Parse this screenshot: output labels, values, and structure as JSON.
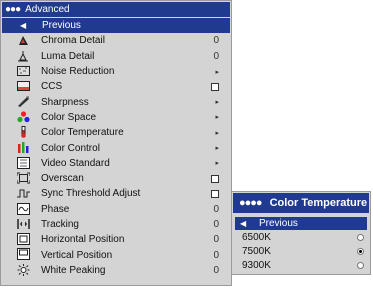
{
  "advanced_menu": {
    "title": "Advanced",
    "items": [
      {
        "label": "Previous",
        "selected": true
      },
      {
        "label": "Chroma Detail",
        "value": "0",
        "icon": "chroma-icon"
      },
      {
        "label": "Luma Detail",
        "value": "0",
        "icon": "luma-icon"
      },
      {
        "label": "Noise Reduction",
        "value": "▸",
        "icon": "noise-icon"
      },
      {
        "label": "CCS",
        "control": "checkbox",
        "icon": "ccs-icon"
      },
      {
        "label": "Sharpness",
        "value": "▸",
        "icon": "sharpness-icon"
      },
      {
        "label": "Color Space",
        "value": "▸",
        "icon": "color-space-icon"
      },
      {
        "label": "Color Temperature",
        "value": "▸",
        "icon": "thermometer-icon"
      },
      {
        "label": "Color Control",
        "value": "▸",
        "icon": "color-control-icon"
      },
      {
        "label": "Video Standard",
        "value": "▸",
        "icon": "video-standard-icon"
      },
      {
        "label": "Overscan",
        "control": "checkbox",
        "icon": "overscan-icon"
      },
      {
        "label": "Sync Threshold Adjust",
        "control": "checkbox",
        "icon": "sync-icon"
      },
      {
        "label": "Phase",
        "value": "0",
        "icon": "phase-icon"
      },
      {
        "label": "Tracking",
        "value": "0",
        "icon": "tracking-icon"
      },
      {
        "label": "Horizontal Position",
        "value": "0",
        "icon": "horizontal-position-icon"
      },
      {
        "label": "Vertical Position",
        "value": "0",
        "icon": "vertical-position-icon"
      },
      {
        "label": "White Peaking",
        "value": "0",
        "icon": "white-peaking-icon"
      }
    ]
  },
  "color_temperature_menu": {
    "title": "Color Temperature",
    "previous_label": "Previous",
    "options": [
      {
        "label": "6500K",
        "checked": false
      },
      {
        "label": "7500K",
        "checked": true
      },
      {
        "label": "9300K",
        "checked": false
      }
    ]
  },
  "colors": {
    "title_bar": "#203a8f",
    "menu_bg": "#d4d4d4"
  }
}
